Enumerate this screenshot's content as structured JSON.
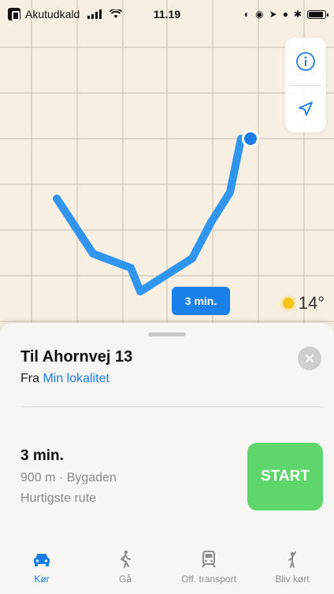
{
  "status_bar": {
    "carrier": "Akutudkald",
    "time": "11.19"
  },
  "map": {
    "eta_label": "3 min.",
    "temperature": "14°",
    "controls": [
      "info-icon",
      "location-arrow-icon"
    ]
  },
  "card": {
    "title": "Til Ahornvej 13",
    "from_prefix": "Fra",
    "from_link": "Min lokalitet",
    "route": {
      "time": "3 min.",
      "distance": "900 m · Bygaden",
      "description": "Hurtigste rute"
    },
    "start_label": "START"
  },
  "tabs": [
    {
      "label": "Kør",
      "icon": "car-icon",
      "active": true
    },
    {
      "label": "Gå",
      "icon": "walk-icon",
      "active": false
    },
    {
      "label": "Off. transport",
      "icon": "train-icon",
      "active": false
    },
    {
      "label": "Bliv kørt",
      "icon": "hail-icon",
      "active": false
    }
  ],
  "colors": {
    "accent": "#1a7de8",
    "route": "#2f95ee",
    "start": "#5ed66b"
  }
}
